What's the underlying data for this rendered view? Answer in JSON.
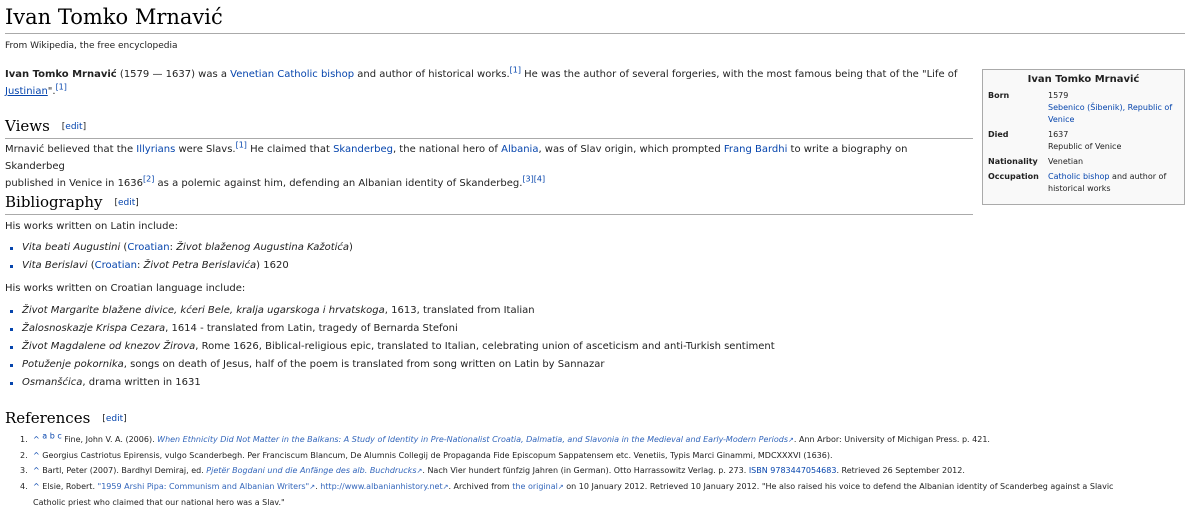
{
  "title": "Ivan Tomko Mrnavić",
  "site_sub": "From Wikipedia, the free encyclopedia",
  "intro": {
    "name": "Ivan Tomko Mrnavić",
    "t1": " (1579 — 1637) was a ",
    "l_venetian": "Venetian",
    "t2": " ",
    "l_catholic_bishop": "Catholic bishop",
    "t3": " and author of historical works.",
    "c1": "[1]",
    "t4": " He was the author of several forgeries, with the most famous being that of the \"Life of ",
    "l_justinian": "Justinian",
    "t5": "\".",
    "c2": "[1]"
  },
  "sections": {
    "views": "Views",
    "bibliography": "Bibliography",
    "references": "References",
    "edit": "edit"
  },
  "views_para": {
    "t1": "Mrnavić believed that the ",
    "l_illyrians": "Illyrians",
    "t2": " were Slavs.",
    "c1": "[1]",
    "t3": " He claimed that ",
    "l_skanderbeg": "Skanderbeg",
    "t4": ", the national hero of ",
    "l_albania": "Albania",
    "t5": ", was of Slav origin, which prompted ",
    "l_frang": "Frang Bardhi",
    "t6": " to write a biography on Skanderbeg",
    "t7": "published in Venice in 1636",
    "c2": "[2]",
    "t8": " as a polemic against him, defending an Albanian identity of Skanderbeg.",
    "c3": "[3]",
    "c4": "[4]"
  },
  "bibliography": {
    "latin_intro": "His works written on Latin include:",
    "latin": [
      {
        "title": "Vita beati Augustini",
        "open": " (",
        "lang": "Croatian",
        "colon": ": ",
        "trans": "Život blaženog Augustina Kažotića",
        "close": ")"
      },
      {
        "title": "Vita Berislavi",
        "open": " (",
        "lang": "Croatian",
        "colon": ": ",
        "trans": "Život Petra Berislavića",
        "close": ") 1620"
      }
    ],
    "croatian_intro": "His works written on Croatian language include:",
    "croatian": [
      {
        "title": "Život Margarite blažene divice, kćeri Bele, kralja ugarskoga i hrvatskoga",
        "rest": ", 1613, translated from Italian"
      },
      {
        "title": "Žalosnoskazje Krispa Cezara",
        "rest": ", 1614 - translated from Latin, tragedy of Bernarda Stefoni"
      },
      {
        "title": "Život Magdalene od knezov Žirova",
        "rest": ", Rome 1626, Biblical-religious epic, translated to Italian, celebrating union of asceticism and anti-Turkish sentiment"
      },
      {
        "title": "Potuženje pokornika",
        "rest": ", songs on death of Jesus, half of the poem is translated from song written on Latin by Sannazar"
      },
      {
        "title": "Osmanšćica",
        "rest": ", drama written in 1631"
      }
    ]
  },
  "references": [
    {
      "num": "1.",
      "back": "^",
      "letters": "a b c",
      "pre": " Fine, John V. A. (2006). ",
      "link": "When Ethnicity Did Not Matter in the Balkans: A Study of Identity in Pre-Nationalist Croatia, Dalmatia, and Slavonia in the Medieval and Early-Modern Periods",
      "post": ". Ann Arbor: University of Michigan Press. p. 421."
    },
    {
      "num": "2.",
      "back": "^",
      "pre": " Georgius Castriotus Epirensis, vulgo Scanderbegh. Per Franciscum Blancum, De Alumnis Collegij de Propaganda Fide Episcopum Sappatensem etc. Venetiis, Typis Marci Ginammi, MDCXXXVI (1636)."
    },
    {
      "num": "3.",
      "back": "^",
      "pre": " Bartl, Peter (2007). Bardhyl Demiraj, ed. ",
      "link": "Pjetër Bogdani und die Anfänge des alb. Buchdrucks",
      "mid": ". Nach Vier hundert fünfzig Jahren (in German). Otto Harrassowitz Verlag. p. 273. ",
      "isbn_label": "ISBN",
      "isbn": "9783447054683",
      "post": ". Retrieved 26 September 2012."
    },
    {
      "num": "4.",
      "back": "^",
      "pre": " Elsie, Robert. ",
      "link": "\"1959 Arshi Pipa: Communism and Albanian Writers\"",
      "mid": ". ",
      "link2": "http://www.albanianhistory.net",
      "mid2": ". Archived from ",
      "link3": "the original",
      "post": " on 10 January 2012. Retrieved 10 January 2012. \"He also raised his voice to defend the Albanian identity of Scanderbeg against a Slavic",
      "post2": "Catholic priest who claimed that our national hero was a Slav.\""
    }
  ],
  "infobox": {
    "title": "Ivan Tomko Mrnavić",
    "born_label": "Born",
    "born_year": "1579",
    "born_place": "Sebenico (Šibenik), Republic of Venice",
    "died_label": "Died",
    "died_year": "1637",
    "died_place": "Republic of Venice",
    "nationality_label": "Nationality",
    "nationality": "Venetian",
    "occupation_label": "Occupation",
    "occupation_link": "Catholic bishop",
    "occupation_rest": " and author of historical works"
  },
  "ext_icon": "external-link-icon",
  "colors": {
    "link": "#0645ad",
    "ext_link": "#3366bb",
    "text": "#222222",
    "border": "#aaaaaa",
    "infobox_bg": "#f9f9f9"
  }
}
